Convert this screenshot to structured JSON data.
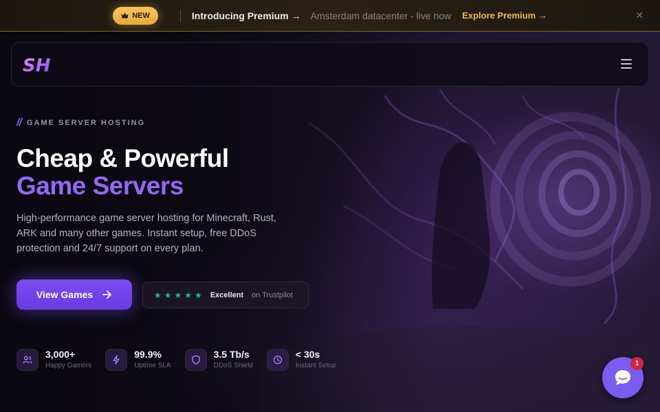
{
  "banner": {
    "badge_label": "NEW",
    "badge_icon": "crown-icon",
    "intro": "Introducing Premium →",
    "datacenter": "Amsterdam datacenter - live now",
    "explore": "Explore Premium",
    "accent": "#f2b84a"
  },
  "nav": {
    "logo_text": "SH",
    "menu_icon": "hamburger-icon"
  },
  "hero": {
    "eyebrow_mark": "//",
    "eyebrow": "GAME SERVER HOSTING",
    "title_line1": "Cheap & Powerful",
    "title_line2": "Game Servers",
    "description": "High-performance game server hosting for Minecraft, Rust, ARK and many other games. Instant setup, free DDoS protection and 24/7 support on every plan.",
    "cta_label": "View Games",
    "accent": "#8a5cf6"
  },
  "trustpilot": {
    "stars": 5,
    "rating_label": "Excellent",
    "source": "on Trustpilot",
    "star_color": "#1fbf82"
  },
  "stats": [
    {
      "icon": "users-icon",
      "value": "3,000+",
      "label": "Happy Gamers"
    },
    {
      "icon": "lightning-icon",
      "value": "99.9%",
      "label": "Uptime SLA"
    },
    {
      "icon": "shield-icon",
      "value": "3.5 Tb/s",
      "label": "DDoS Shield"
    },
    {
      "icon": "clock-icon",
      "value": "< 30s",
      "label": "Instant Setup"
    }
  ],
  "chat": {
    "icon": "chat-bubble-icon",
    "unread_count": "1"
  }
}
